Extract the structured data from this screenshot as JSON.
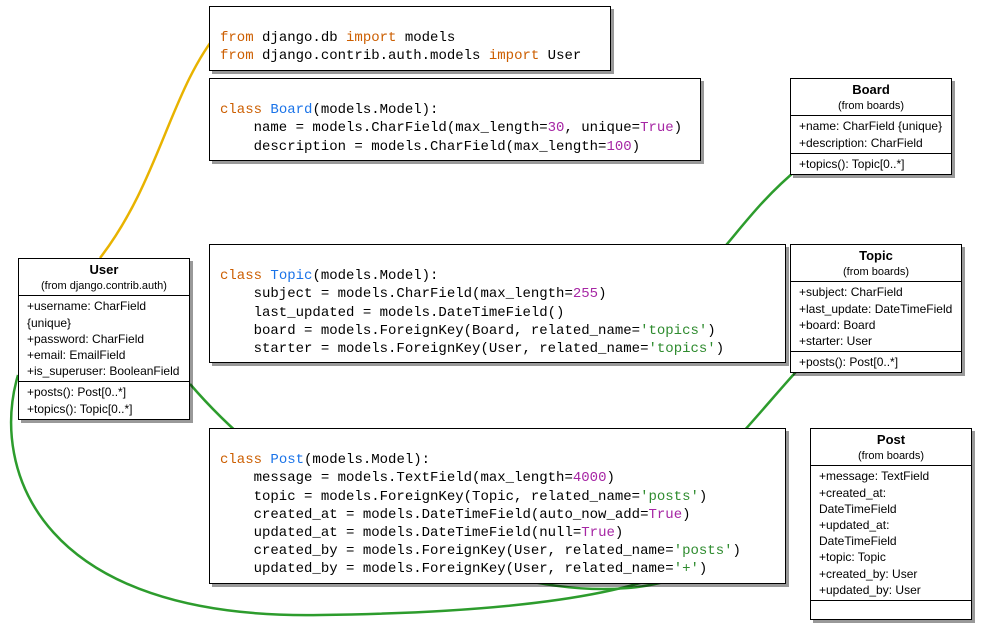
{
  "imports": {
    "line1_from": "from",
    "line1_mod": " django.db ",
    "line1_import": "import",
    "line1_what": " models",
    "line2_from": "from",
    "line2_mod": " django.contrib.auth.models ",
    "line2_import": "import",
    "line2_what": " User"
  },
  "board_code": {
    "class_kw": "class",
    "name": " Board",
    "sig": "(models.Model):",
    "l1a": "    name = models.CharField(max_length=",
    "l1b": "30",
    "l1c": ", unique=",
    "l1d": "True",
    "l1e": ")",
    "l2a": "    description = models.CharField(max_length=",
    "l2b": "100",
    "l2c": ")"
  },
  "topic_code": {
    "class_kw": "class",
    "name": " Topic",
    "sig": "(models.Model):",
    "l1a": "    subject = models.CharField(max_length=",
    "l1b": "255",
    "l1c": ")",
    "l2": "    last_updated = models.DateTimeField()",
    "l3a": "    board = models.ForeignKey(Board, related_name=",
    "l3b": "'topics'",
    "l3c": ")",
    "l4a": "    starter = models.ForeignKey(User, related_name=",
    "l4b": "'topics'",
    "l4c": ")"
  },
  "post_code": {
    "class_kw": "class",
    "name": " Post",
    "sig": "(models.Model):",
    "l1a": "    message = models.TextField(max_length=",
    "l1b": "4000",
    "l1c": ")",
    "l2a": "    topic = models.ForeignKey(Topic, related_name=",
    "l2b": "'posts'",
    "l2c": ")",
    "l3a": "    created_at = models.DateTimeField(auto_now_add=",
    "l3b": "True",
    "l3c": ")",
    "l4a": "    updated_at = models.DateTimeField(null=",
    "l4b": "True",
    "l4c": ")",
    "l5a": "    created_by = models.ForeignKey(User, related_name=",
    "l5b": "'posts'",
    "l5c": ")",
    "l6a": "    updated_by = models.ForeignKey(User, related_name=",
    "l6b": "'+'",
    "l6c": ")"
  },
  "uml_user": {
    "title": "User",
    "sub": "(from django.contrib.auth)",
    "a1": "+username: CharField {unique}",
    "a2": "+password: CharField",
    "a3": "+email: EmailField",
    "a4": "+is_superuser: BooleanField",
    "m1": "+posts(): Post[0..*]",
    "m2": "+topics(): Topic[0..*]"
  },
  "uml_board": {
    "title": "Board",
    "sub": "(from boards)",
    "a1": "+name: CharField {unique}",
    "a2": "+description: CharField",
    "m1": "+topics(): Topic[0..*]"
  },
  "uml_topic": {
    "title": "Topic",
    "sub": "(from boards)",
    "a1": "+subject: CharField",
    "a2": "+last_update: DateTimeField",
    "a3": "+board: Board",
    "a4": "+starter: User",
    "m1": "+posts(): Post[0..*]"
  },
  "uml_post": {
    "title": "Post",
    "sub": "(from boards)",
    "a1": "+message: TextField",
    "a2": "+created_at: DateTimeField",
    "a3": "+updated_at: DateTimeField",
    "a4": "+topic: Topic",
    "a5": "+created_by: User",
    "a6": "+updated_by: User"
  }
}
